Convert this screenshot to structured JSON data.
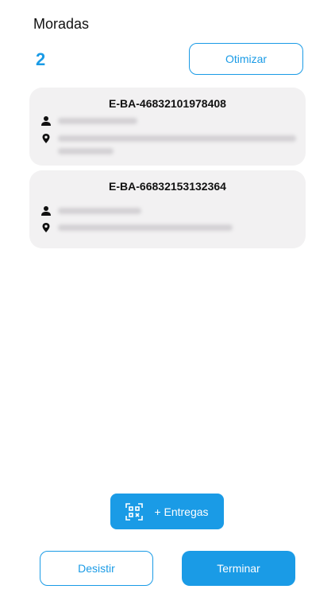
{
  "header": {
    "title": "Moradas"
  },
  "summary": {
    "count": "2",
    "optimize_label": "Otimizar"
  },
  "deliveries": [
    {
      "code": "E-BA-46832101978408"
    },
    {
      "code": "E-BA-66832153132364"
    }
  ],
  "actions": {
    "add_deliveries_label": "+ Entregas",
    "cancel_label": "Desistir",
    "finish_label": "Terminar"
  },
  "colors": {
    "accent": "#1a9be6",
    "card_bg": "#f2f1f2"
  },
  "icons": {
    "person": "person-icon",
    "location": "location-pin-icon",
    "qr": "qr-scan-icon"
  }
}
